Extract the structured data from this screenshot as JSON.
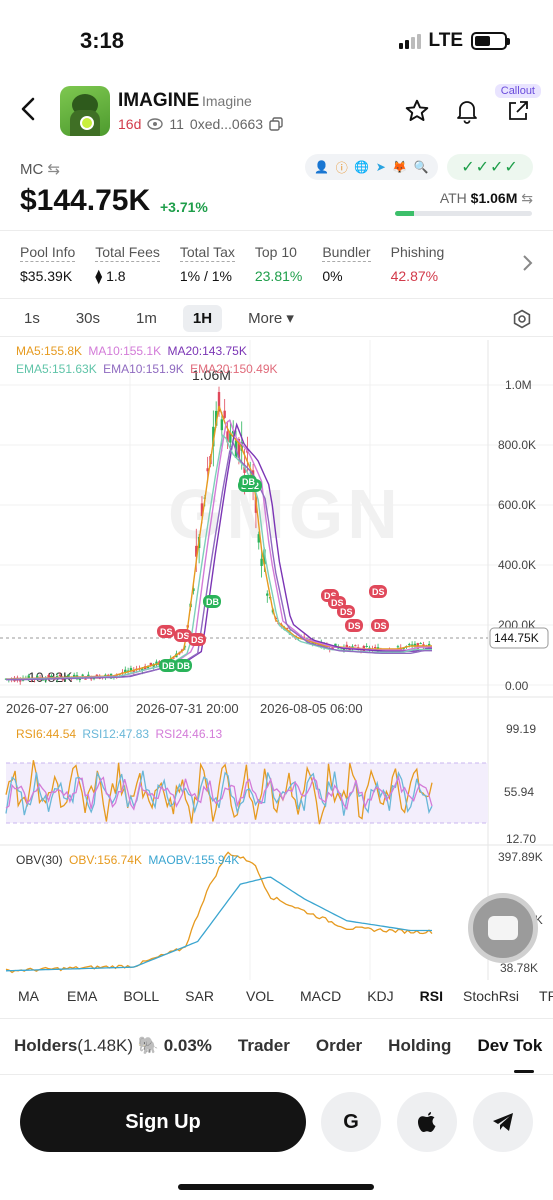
{
  "status": {
    "time": "3:18",
    "network": "LTE"
  },
  "token": {
    "name": "IMAGINE",
    "subname": "Imagine",
    "age": "16d",
    "views": "11",
    "address": "0xed...0663",
    "callout": "Callout"
  },
  "market": {
    "mc_label": "MC",
    "mc_value": "$144.75K",
    "mc_change": "+3.71%",
    "ath_label": "ATH",
    "ath_value": "$1.06M",
    "ath_progress": 0.14,
    "checks": "✓✓✓✓"
  },
  "stats": [
    {
      "label": "Pool Info",
      "value": "$35.39K",
      "tone": ""
    },
    {
      "label": "Total Fees",
      "value": "1.8",
      "tone": ""
    },
    {
      "label": "Total Tax",
      "value": "1% / 1%",
      "tone": ""
    },
    {
      "label": "Top 10",
      "value": "23.81%",
      "tone": "green"
    },
    {
      "label": "Bundler",
      "value": "0%",
      "tone": ""
    },
    {
      "label": "Phishing",
      "value": "42.87%",
      "tone": "red"
    }
  ],
  "timeframes": [
    "1s",
    "30s",
    "1m",
    "1H",
    "More"
  ],
  "active_timeframe": "1H",
  "chart_legend": {
    "ma5": "MA5:155.8K",
    "ma10": "MA10:155.1K",
    "ma20": "MA20:143.75K",
    "ema5": "EMA5:151.63K",
    "ema10": "EMA10:151.9K",
    "ema20": "EMA20:150.49K",
    "max_label": "1.06M",
    "min_label": "10.82K",
    "current_price": "144.75K",
    "y_ticks": [
      "1.0M",
      "800.0K",
      "600.0K",
      "400.0K",
      "200.0K",
      "0.00"
    ],
    "x_ticks": [
      "2026-07-27 06:00",
      "2026-07-31 20:00",
      "2026-08-05 06:00"
    ],
    "colors": {
      "ma5": "#e69a1f",
      "ma10": "#d37bd8",
      "ma20": "#7b35b5",
      "ema5": "#7ecfb9",
      "ema10": "#8f6ac0",
      "ema20": "#e06a7a",
      "up": "#2ab35a",
      "down": "#e0485a"
    }
  },
  "rsi": {
    "rsi6": "RSI6:44.54",
    "rsi12": "RSI12:47.83",
    "rsi24": "RSI24:46.13",
    "ticks": [
      "99.19",
      "55.94",
      "12.70"
    ]
  },
  "obv": {
    "label": "OBV(30)",
    "obv": "OBV:156.74K",
    "maobv": "MAOBV:155.94K",
    "ticks": [
      "397.89K",
      "218.34K",
      "38.78K"
    ]
  },
  "chart_data": {
    "type": "line",
    "title": "",
    "xlabel": "",
    "ylabel": "",
    "x": [
      "2026-07-27 06:00",
      "2026-07-31 20:00",
      "2026-08-05 06:00"
    ],
    "series": [
      {
        "name": "MA5",
        "values": [
          20000,
          90000,
          880000,
          160000,
          155800
        ]
      },
      {
        "name": "MA10",
        "values": [
          20000,
          80000,
          820000,
          170000,
          155100
        ]
      },
      {
        "name": "MA20",
        "values": [
          20000,
          70000,
          760000,
          180000,
          143750
        ]
      }
    ],
    "ylim": [
      0,
      1100000
    ],
    "markers": [
      "DB",
      "DB2",
      "DS"
    ]
  },
  "indicators": [
    "MA",
    "EMA",
    "BOLL",
    "SAR",
    "VOL",
    "MACD",
    "KDJ",
    "RSI",
    "StochRsi",
    "TRIX"
  ],
  "tabs": {
    "holders": "Holders",
    "holders_count": "(1.48K)",
    "dev_pct": "0.03%",
    "trader": "Trader",
    "order": "Order",
    "holding": "Holding",
    "devtok": "Dev Tok"
  },
  "footer": {
    "signup": "Sign Up",
    "google": "G"
  }
}
